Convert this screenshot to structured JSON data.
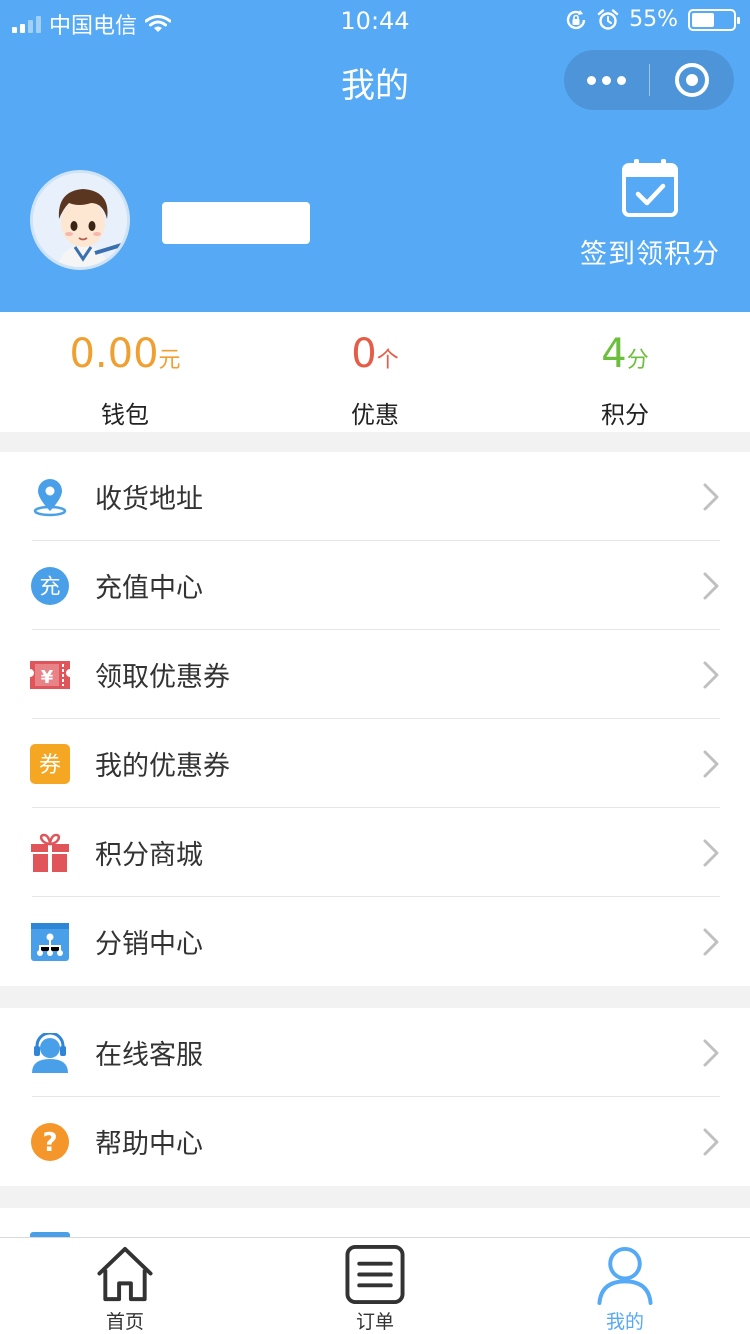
{
  "status_bar": {
    "carrier": "中国电信",
    "time": "10:44",
    "battery_percent": "55%",
    "battery_level": 0.55
  },
  "navbar": {
    "title": "我的"
  },
  "profile": {
    "checkin_label": "签到领积分"
  },
  "stats": [
    {
      "value": "0.00",
      "unit": "元",
      "label": "钱包",
      "color": "#f0a030"
    },
    {
      "value": "0",
      "unit": "个",
      "label": "优惠",
      "color": "#e55d47"
    },
    {
      "value": "4",
      "unit": "分",
      "label": "积分",
      "color": "#6cbf3c"
    }
  ],
  "menu_group1": [
    {
      "label": "收货地址",
      "icon": "location-pin-icon"
    },
    {
      "label": "充值中心",
      "icon": "recharge-icon",
      "icon_text": "充"
    },
    {
      "label": "领取优惠券",
      "icon": "coupon-ticket-icon",
      "icon_text": "¥"
    },
    {
      "label": "我的优惠券",
      "icon": "my-coupon-icon",
      "icon_text": "券"
    },
    {
      "label": "积分商城",
      "icon": "gift-icon"
    },
    {
      "label": "分销中心",
      "icon": "distribution-icon"
    }
  ],
  "menu_group2": [
    {
      "label": "在线客服",
      "icon": "customer-service-icon"
    },
    {
      "label": "帮助中心",
      "icon": "help-icon",
      "icon_text": "?"
    }
  ],
  "tabs": [
    {
      "label": "首页",
      "icon": "home-icon"
    },
    {
      "label": "订单",
      "icon": "orders-icon"
    },
    {
      "label": "我的",
      "icon": "user-icon"
    }
  ],
  "colors": {
    "primary": "#56aaf5",
    "icon_blue": "#4aa0e8",
    "icon_red": "#e0555a",
    "icon_orange": "#f5a623",
    "chevron": "#c0c0c0"
  }
}
